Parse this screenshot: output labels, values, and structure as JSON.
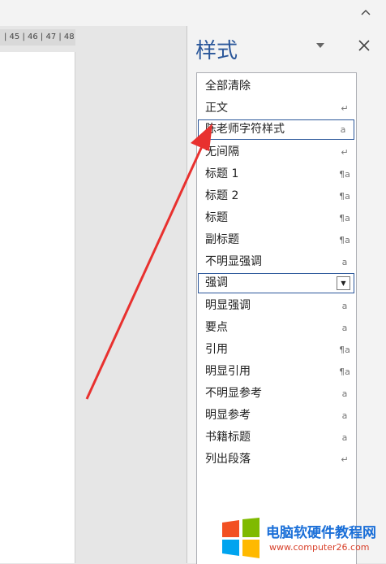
{
  "ruler": {
    "text": "| 45 | 46 | 47 | 48"
  },
  "window": {
    "collapse_icon": "chevron-up-icon"
  },
  "pane": {
    "title": "样式",
    "menu_icon": "triangle-down-icon",
    "close_icon": "close-icon",
    "items": [
      {
        "label": "全部清除",
        "marker": ""
      },
      {
        "label": "正文",
        "marker": "↵"
      },
      {
        "label": "陈老师字符样式",
        "marker": "a"
      },
      {
        "label": "无间隔",
        "marker": "↵"
      },
      {
        "label": "标题 1",
        "marker": "¶a"
      },
      {
        "label": "标题 2",
        "marker": "¶a"
      },
      {
        "label": "标题",
        "marker": "¶a"
      },
      {
        "label": "副标题",
        "marker": "¶a"
      },
      {
        "label": "不明显强调",
        "marker": "a"
      },
      {
        "label": "强调",
        "marker": "▼"
      },
      {
        "label": "明显强调",
        "marker": "a"
      },
      {
        "label": "要点",
        "marker": "a"
      },
      {
        "label": "引用",
        "marker": "¶a"
      },
      {
        "label": "明显引用",
        "marker": "¶a"
      },
      {
        "label": "不明显参考",
        "marker": "a"
      },
      {
        "label": "明显参考",
        "marker": "a"
      },
      {
        "label": "书籍标题",
        "marker": "a"
      },
      {
        "label": "列出段落",
        "marker": "↵"
      }
    ]
  },
  "watermark": {
    "text": "电脑软硬件教程网",
    "url": "www.computer26.com"
  },
  "colors": {
    "accent": "#2b579a",
    "arrow": "#e8312f",
    "logo": [
      "#f25022",
      "#7fba00",
      "#00a4ef",
      "#ffb900"
    ]
  }
}
